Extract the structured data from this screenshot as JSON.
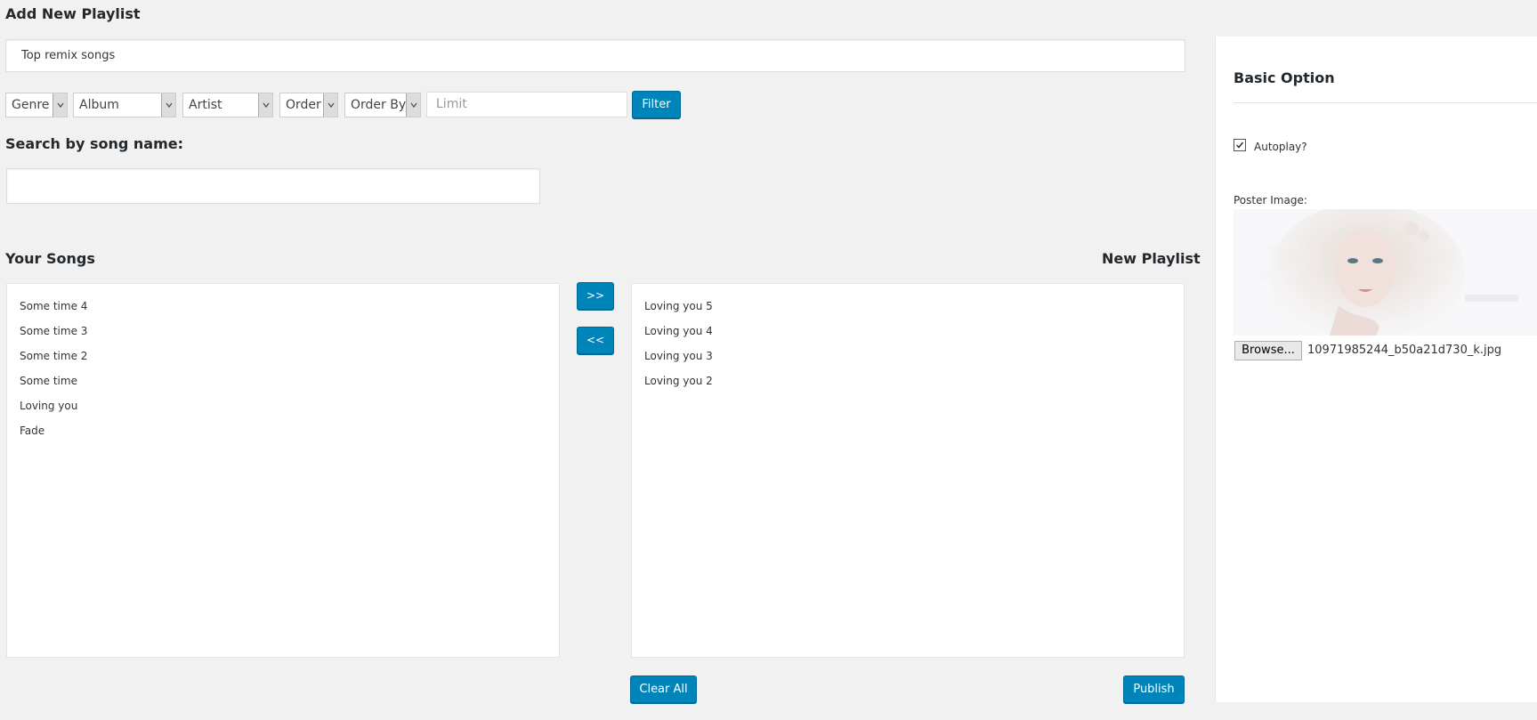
{
  "page": {
    "title": "Add New Playlist",
    "playlist_name_value": "Top remix songs"
  },
  "filters": {
    "genre": "Genre",
    "album": "Album",
    "artist": "Artist",
    "order": "Order",
    "order_by": "Order By",
    "limit_placeholder": "Limit",
    "filter_button": "Filter"
  },
  "search": {
    "label": "Search by song name:",
    "value": ""
  },
  "your_songs": {
    "heading": "Your Songs",
    "items": [
      "Some time 4",
      "Some time 3",
      "Some time 2",
      "Some time",
      "Loving you",
      "Fade"
    ]
  },
  "new_playlist": {
    "heading": "New Playlist",
    "items": [
      "Loving you 5",
      "Loving you 4",
      "Loving you 3",
      "Loving you 2"
    ]
  },
  "actions": {
    "move_right": ">>",
    "move_left": "<<",
    "clear_all": "Clear All",
    "publish": "Publish"
  },
  "basic_option": {
    "title": "Basic Option",
    "autoplay_label": "Autoplay?",
    "autoplay_checked": true,
    "poster_label": "Poster Image:",
    "browse_label": "Browse...",
    "file_name": "10971985244_b50a21d730_k.jpg"
  },
  "colors": {
    "primary_button": "#0085ba",
    "background": "#f1f1f1",
    "panel": "#ffffff"
  }
}
